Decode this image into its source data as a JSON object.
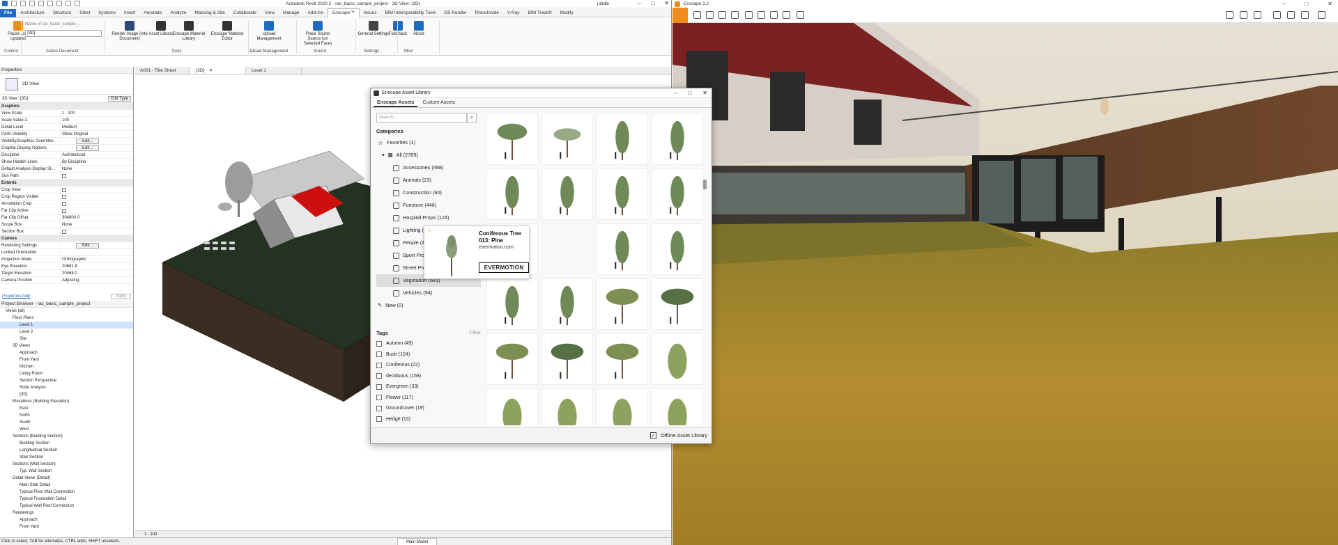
{
  "revit": {
    "title": "Autodesk Revit 2020.2 - rac_basic_sample_project - 3D View: {3D}",
    "user": "j.bidle",
    "tabs": [
      "File",
      "Architecture",
      "Structure",
      "Steel",
      "Systems",
      "Insert",
      "Annotate",
      "Analyze",
      "Massing & Site",
      "Collaborate",
      "View",
      "Manage",
      "Add-Ins",
      "Enscape™",
      "Issues",
      "BIM Interoperability Tools",
      "DS Render",
      "RhinoInside",
      "V-Ray",
      "BIM Track®",
      "Modify"
    ],
    "active_tab": "Enscape™",
    "ribbon": {
      "buttons": [
        {
          "label": "Pause Live Updates"
        },
        {
          "label": "Render Image (into Document)"
        },
        {
          "label": "Asset Library"
        },
        {
          "label": "Enscape Material Library"
        },
        {
          "label": "Enscape Material Editor"
        },
        {
          "label": "Upload Management"
        },
        {
          "label": "Place Sound Source (on Selected Face)"
        },
        {
          "label": "General Settings"
        },
        {
          "label": "Feedback"
        },
        {
          "label": "About"
        }
      ],
      "view_dropdown": "{3D}",
      "view_dropdown_hint": "Name of rac_basic_sample_...",
      "groups": [
        "Control",
        "Active Document",
        "Tools",
        "Upload Management",
        "Sound",
        "Settings",
        "Misc"
      ]
    },
    "properties": {
      "header": "Properties",
      "type_name": "3D View",
      "instance_selector": "3D View: {3D}",
      "edit_type": "Edit Type",
      "rows": [
        {
          "k": "Graphics",
          "v": "",
          "sec": true
        },
        {
          "k": "View Scale",
          "v": "1 : 100"
        },
        {
          "k": "Scale Value    1:",
          "v": "100"
        },
        {
          "k": "Detail Level",
          "v": "Medium"
        },
        {
          "k": "Parts Visibility",
          "v": "Show Original"
        },
        {
          "k": "Visibility/Graphics Overrides",
          "v": "Edit...",
          "btn": true
        },
        {
          "k": "Graphic Display Options",
          "v": "Edit...",
          "btn": true
        },
        {
          "k": "Discipline",
          "v": "Architectural"
        },
        {
          "k": "Show Hidden Lines",
          "v": "By Discipline"
        },
        {
          "k": "Default Analysis Display St...",
          "v": "None"
        },
        {
          "k": "Sun Path",
          "v": "",
          "cb": true
        },
        {
          "k": "Extents",
          "v": "",
          "sec": true
        },
        {
          "k": "Crop View",
          "v": "",
          "cb": true
        },
        {
          "k": "Crop Region Visible",
          "v": "",
          "cb": true
        },
        {
          "k": "Annotation Crop",
          "v": "",
          "cb": true
        },
        {
          "k": "Far Clip Active",
          "v": "",
          "cb": true
        },
        {
          "k": "Far Clip Offset",
          "v": "304800.0"
        },
        {
          "k": "Scope Box",
          "v": "None"
        },
        {
          "k": "Section Box",
          "v": "",
          "cb": true
        },
        {
          "k": "Camera",
          "v": "",
          "sec": true
        },
        {
          "k": "Rendering Settings",
          "v": "Edit...",
          "btn": true
        },
        {
          "k": "Locked Orientation",
          "v": ""
        },
        {
          "k": "Projection Mode",
          "v": "Orthographic"
        },
        {
          "k": "Eye Elevation",
          "v": "20681.8"
        },
        {
          "k": "Target Elevation",
          "v": "20468.0"
        },
        {
          "k": "Camera Position",
          "v": "Adjusting"
        }
      ],
      "help_link": "Properties help",
      "apply": "Apply"
    },
    "browser": {
      "header": "Project Browser - rac_basic_sample_project",
      "nodes": [
        {
          "t": "Views (all)",
          "d": 0
        },
        {
          "t": "Floor Plans",
          "d": 1
        },
        {
          "t": "Level 1",
          "d": 2,
          "sel": true
        },
        {
          "t": "Level 2",
          "d": 2
        },
        {
          "t": "Site",
          "d": 2
        },
        {
          "t": "3D Views",
          "d": 1
        },
        {
          "t": "Approach",
          "d": 2
        },
        {
          "t": "From Yard",
          "d": 2
        },
        {
          "t": "Kitchen",
          "d": 2
        },
        {
          "t": "Living Room",
          "d": 2
        },
        {
          "t": "Section Perspective",
          "d": 2
        },
        {
          "t": "Solar Analysis",
          "d": 2
        },
        {
          "t": "{3D}",
          "d": 2
        },
        {
          "t": "Elevations (Building Elevation)",
          "d": 1
        },
        {
          "t": "East",
          "d": 2
        },
        {
          "t": "North",
          "d": 2
        },
        {
          "t": "South",
          "d": 2
        },
        {
          "t": "West",
          "d": 2
        },
        {
          "t": "Sections (Building Section)",
          "d": 1
        },
        {
          "t": "Building Section",
          "d": 2
        },
        {
          "t": "Longitudinal Section",
          "d": 2
        },
        {
          "t": "Stair Section",
          "d": 2
        },
        {
          "t": "Sections (Wall Section)",
          "d": 1
        },
        {
          "t": "Typ. Wall Section",
          "d": 2
        },
        {
          "t": "Detail Views (Detail)",
          "d": 1
        },
        {
          "t": "Main Stair Detail",
          "d": 2
        },
        {
          "t": "Typical Floor Wall Connection",
          "d": 2
        },
        {
          "t": "Typical Foundation Detail",
          "d": 2
        },
        {
          "t": "Typical Wall Roof Connection",
          "d": 2
        },
        {
          "t": "Renderings",
          "d": 1
        },
        {
          "t": "Approach",
          "d": 2
        },
        {
          "t": "From Yard",
          "d": 2
        }
      ]
    },
    "view_tabs": [
      "A001 - Title Sheet",
      "{3D}",
      "Level 1"
    ],
    "view_scale": "1 : 100",
    "status": "Click to select, TAB for alternates, CTRL adds, SHIFT unselects.",
    "status_model": "Main Model"
  },
  "asset_library": {
    "title": "Enscape Asset Library",
    "tabs": [
      "Enscape Assets",
      "Custom Assets"
    ],
    "search_placeholder": "Search",
    "categories_label": "Categories",
    "favorites": "Favorites (1)",
    "all": "All (2789)",
    "categories": [
      {
        "label": "Accessories (488)",
        "icon": "accessories-icon"
      },
      {
        "label": "Animals (23)",
        "icon": "animals-icon"
      },
      {
        "label": "Construction (60)",
        "icon": "construction-icon"
      },
      {
        "label": "Furniture (446)",
        "icon": "furniture-icon"
      },
      {
        "label": "Hospital Props (124)",
        "icon": "hospital-icon"
      },
      {
        "label": "Lighting (189)",
        "icon": "lighting-icon"
      },
      {
        "label": "People (415)",
        "icon": "people-icon"
      },
      {
        "label": "Sport Props (123)",
        "icon": "sport-icon"
      },
      {
        "label": "Street Props (144)",
        "icon": "street-icon"
      },
      {
        "label": "Vegetation (681)",
        "icon": "vegetation-icon",
        "sel": true
      },
      {
        "label": "Vehicles (94)",
        "icon": "vehicles-icon"
      }
    ],
    "new": "New (0)",
    "tags_label": "Tags",
    "clear": "Clear",
    "tags": [
      "Autumn (49)",
      "Bush (124)",
      "Coniferous (22)",
      "deciduous (158)",
      "Evergreen (33)",
      "Flower (117)",
      "Groundcover (19)",
      "Hedge (13)"
    ],
    "hover": {
      "name": "Coniferous Tree 013: Pine",
      "source": "evermotion.com",
      "brand": "EVERMOTION"
    },
    "offline": "Offline Asset Library"
  },
  "enscape": {
    "title": "Enscape 3.2"
  }
}
